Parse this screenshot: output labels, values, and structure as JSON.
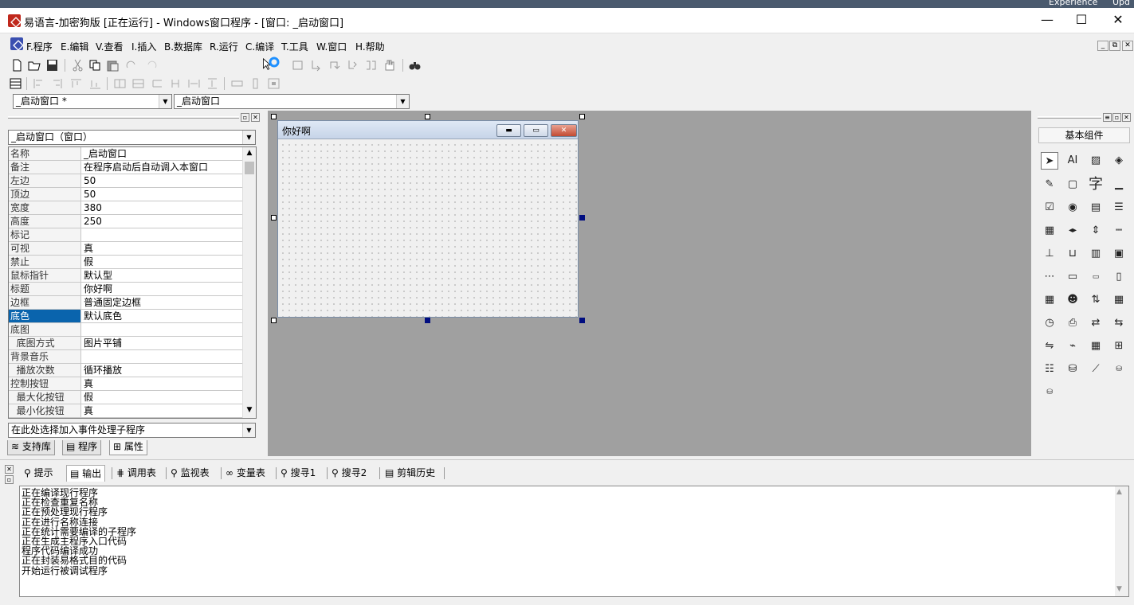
{
  "window": {
    "title": "易语言-加密狗版 [正在运行] - Windows窗口程序 - [窗口: _启动窗口]",
    "controls": [
      "—",
      "☐",
      "✕"
    ]
  },
  "topstrip": {
    "left": "Experience",
    "right": "Upd"
  },
  "menubar": {
    "items": [
      "F.程序",
      "E.编辑",
      "V.查看",
      "I.插入",
      "B.数据库",
      "R.运行",
      "C.编译",
      "T.工具",
      "W.窗口",
      "H.帮助"
    ],
    "mdi_controls": [
      "_",
      "⧉",
      "✕"
    ]
  },
  "combos": {
    "window_select": "_启动窗口 *",
    "component_select": "_启动窗口"
  },
  "properties": {
    "object_select": "_启动窗口（窗口）",
    "rows": [
      {
        "name": "名称",
        "value": "_启动窗口"
      },
      {
        "name": "备注",
        "value": "在程序启动后自动调入本窗口"
      },
      {
        "name": "左边",
        "value": "50"
      },
      {
        "name": "顶边",
        "value": "50"
      },
      {
        "name": "宽度",
        "value": "380"
      },
      {
        "name": "高度",
        "value": "250"
      },
      {
        "name": "标记",
        "value": ""
      },
      {
        "name": "可视",
        "value": "真"
      },
      {
        "name": "禁止",
        "value": "假"
      },
      {
        "name": "鼠标指针",
        "value": "默认型"
      },
      {
        "name": "标题",
        "value": "你好啊"
      },
      {
        "name": "边框",
        "value": "普通固定边框"
      },
      {
        "name": "底色",
        "value": "默认底色"
      },
      {
        "name": "底图",
        "value": ""
      },
      {
        "name": "  底图方式",
        "value": "图片平铺"
      },
      {
        "name": "背景音乐",
        "value": ""
      },
      {
        "name": "  播放次数",
        "value": "循环播放"
      },
      {
        "name": "控制按钮",
        "value": "真"
      },
      {
        "name": "  最大化按钮",
        "value": "假"
      },
      {
        "name": "  最小化按钮",
        "value": "真"
      }
    ],
    "selected_row": "底色",
    "event_select": "在此处选择加入事件处理子程序"
  },
  "left_tabs": [
    "支持库",
    "程序",
    "属性"
  ],
  "form": {
    "title": "你好啊"
  },
  "right_panel": {
    "header": "基本组件"
  },
  "bottom_tabs": [
    "提示",
    "输出",
    "调用表",
    "监视表",
    "变量表",
    "搜寻1",
    "搜寻2",
    "剪辑历史"
  ],
  "output_lines": [
    "正在编译现行程序",
    "正在检查重复名称",
    "正在预处理现行程序",
    "正在进行名称连接",
    "正在统计需要编译的子程序",
    "正在生成主程序入口代码",
    "程序代码编译成功",
    "正在封装易格式目的代码",
    "开始运行被调试程序"
  ]
}
